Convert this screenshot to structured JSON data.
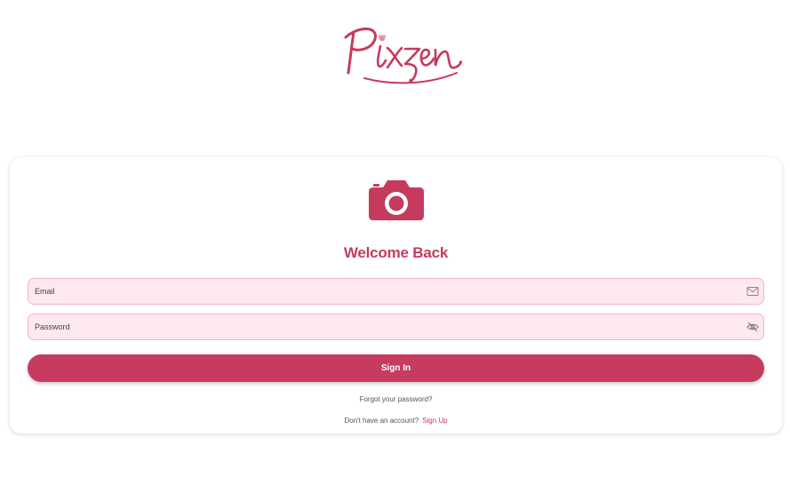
{
  "logo": {
    "text": "Pixzen",
    "brand_color": "#c53b5d"
  },
  "card": {
    "hero_icon": "camera-icon",
    "title": "Welcome Back",
    "email_field": {
      "placeholder": "Email",
      "value": "",
      "icon": "mail-icon"
    },
    "password_field": {
      "placeholder": "Password",
      "value": "",
      "icon": "eye-off-icon"
    },
    "signin_button": "Sign In",
    "forgot_link": "Forgot your password?",
    "signup_prompt": "Don't have an account?",
    "signup_link": "Sign Up"
  },
  "colors": {
    "accent": "#c53b5d",
    "field_bg": "#fde8ee",
    "field_border": "#f3b4c5",
    "button_bg": "#c73b5e"
  }
}
